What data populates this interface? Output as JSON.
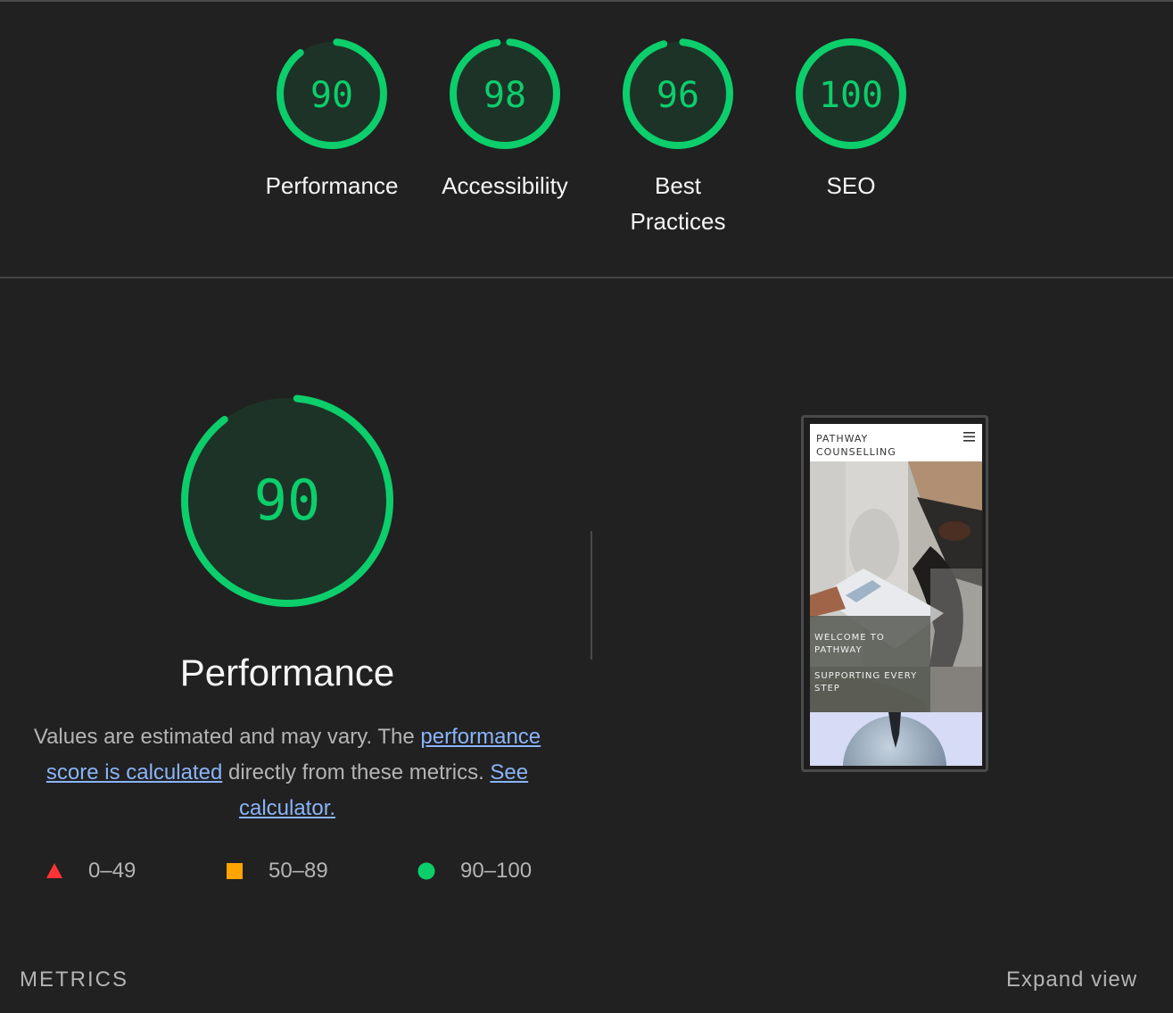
{
  "summary": {
    "gauges": [
      {
        "score": "90",
        "label": "Performance",
        "value": 90
      },
      {
        "score": "98",
        "label": "Accessibility",
        "value": 98
      },
      {
        "score": "96",
        "label_line1": "Best",
        "label_line2": "Practices",
        "value": 96
      },
      {
        "score": "100",
        "label": "SEO",
        "value": 100
      }
    ]
  },
  "performance": {
    "score": "90",
    "value": 90,
    "title": "Performance",
    "desc_part1": "Values are estimated and may vary. The ",
    "link_score": "performance score is calculated",
    "desc_part2": " directly from these metrics. ",
    "link_calc": "See calculator."
  },
  "legend": {
    "fail": "0–49",
    "average": "50–89",
    "pass": "90–100"
  },
  "screenshot": {
    "brand_line1": "PATHWAY",
    "brand_line2": "COUNSELLING",
    "overlay_line1": "WELCOME TO PATHWAY",
    "overlay_line2": "SUPPORTING EVERY STEP"
  },
  "metrics": {
    "label": "METRICS",
    "expand": "Expand view"
  },
  "colors": {
    "background": "#212121",
    "pass": "#0cce6b",
    "pass_fill": "#1e3327",
    "average": "#ffa400",
    "fail": "#ff3333",
    "link": "#8ab4f8"
  },
  "icons": {
    "fail": "triangle-icon",
    "average": "square-icon",
    "pass": "circle-icon",
    "menu": "hamburger-icon"
  }
}
